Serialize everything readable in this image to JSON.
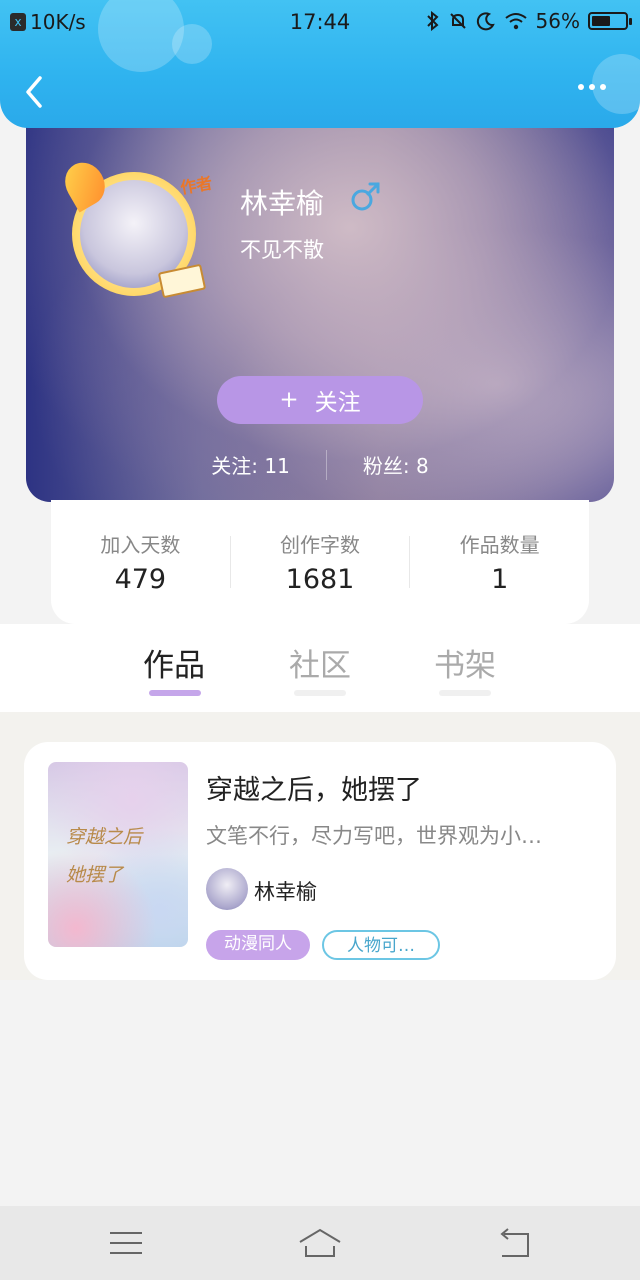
{
  "status_bar": {
    "net_speed": "10K/s",
    "time": "17:44",
    "battery": "56%",
    "battery_level": 0.56
  },
  "header": {
    "back_icon": "chevron-left-icon",
    "more_icon": "more-dots-icon"
  },
  "profile": {
    "name": "林幸榆",
    "gender_icon": "male-icon",
    "bio": "不见不散",
    "avatar_badge": "作者",
    "follow_button": {
      "plus": "+",
      "label": "关注"
    },
    "following": {
      "label": "关注:",
      "value": "11"
    },
    "followers": {
      "label": "粉丝:",
      "value": "8"
    }
  },
  "stats": [
    {
      "label": "加入天数",
      "value": "479"
    },
    {
      "label": "创作字数",
      "value": "1681"
    },
    {
      "label": "作品数量",
      "value": "1"
    }
  ],
  "tabs": [
    {
      "label": "作品",
      "active": true
    },
    {
      "label": "社区",
      "active": false
    },
    {
      "label": "书架",
      "active": false
    }
  ],
  "works": [
    {
      "title": "穿越之后，她摆了",
      "description": "文笔不行，尽力写吧，世界观为小…",
      "author": "林幸榆",
      "cover_text": [
        "穿越之后",
        "她摆了"
      ],
      "tags": [
        "动漫同人",
        "人物可…"
      ]
    }
  ],
  "colors": {
    "header": "#2fb3ef",
    "accent_purple": "#b896e6",
    "tab_indicator_active": "#c5a6ea",
    "tag_outline": "#6cc6e4"
  },
  "navbar": {
    "menu_icon": "menu-icon",
    "home_icon": "home-icon",
    "back_icon": "return-icon"
  }
}
